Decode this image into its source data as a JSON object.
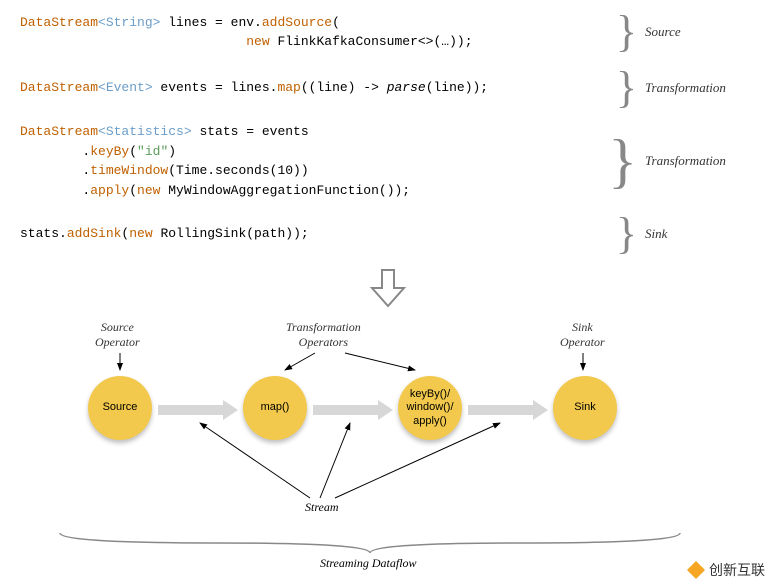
{
  "code": {
    "block1": {
      "line1_part1": "DataStream",
      "line1_gen": "<String>",
      "line1_part2": " lines = env.",
      "line1_method": "addSource",
      "line1_part3": "(",
      "line2_new": "new",
      "line2_part2": " FlinkKafkaConsumer<>(…));",
      "label": "Source"
    },
    "block2": {
      "line1_part1": "DataStream",
      "line1_gen": "<Event>",
      "line1_part2": " events = lines.",
      "line1_method": "map",
      "line1_part3": "((line) -> ",
      "line1_italic": "parse",
      "line1_part4": "(line));",
      "label": "Transformation"
    },
    "block3": {
      "line1_part1": "DataStream",
      "line1_gen": "<Statistics>",
      "line1_part2": " stats = events",
      "line2_indent": "        .",
      "line2_method": "keyBy",
      "line2_part2": "(",
      "line2_str": "\"id\"",
      "line2_part3": ")",
      "line3_method": "timeWindow",
      "line3_part2": "(Time.seconds(10))",
      "line4_method": "apply",
      "line4_part2": "(",
      "line4_new": "new",
      "line4_part3": " MyWindowAggregationFunction());",
      "label": "Transformation"
    },
    "block4": {
      "line1_part1": "stats.",
      "line1_method": "addSink",
      "line1_part2": "(",
      "line1_new": "new",
      "line1_part3": " RollingSink(path));",
      "label": "Sink"
    }
  },
  "diagram": {
    "source_label": "Source\nOperator",
    "transform_label": "Transformation\nOperators",
    "sink_label": "Sink\nOperator",
    "node_source": "Source",
    "node_map": "map()",
    "node_keyby": "keyBy()/\nwindow()/\napply()",
    "node_sink": "Sink",
    "stream_label": "Stream",
    "dataflow_label": "Streaming Dataflow"
  },
  "watermark": "创新互联"
}
